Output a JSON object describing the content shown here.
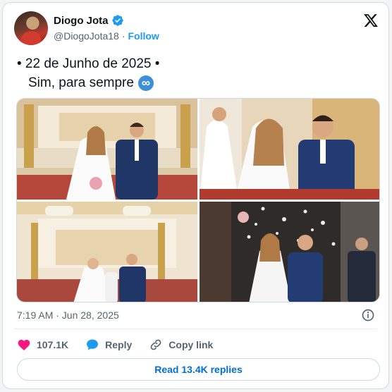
{
  "author": {
    "display_name": "Diogo Jota",
    "handle": "@DiogoJota18",
    "separator": "·",
    "follow_label": "Follow"
  },
  "tweet": {
    "line1": "• 22 de Junho de 2025 •",
    "line2": "Sim, para sempre",
    "emoji": "∞",
    "timestamp": "7:19 AM · Jun 28, 2025"
  },
  "actions": {
    "likes": "107.1K",
    "reply": "Reply",
    "copy_link": "Copy link"
  },
  "read_replies_label": "Read 13.4K replies",
  "colors": {
    "accent": "#1d9bf0",
    "link": "#006fd6",
    "like_heart": "#f91880",
    "reply_bubble": "#1d9bf0",
    "verified": "#1d9bf0"
  },
  "icons": [
    "verified-badge-icon",
    "x-logo-icon",
    "infinity-emoji-icon",
    "info-icon",
    "heart-icon",
    "reply-icon",
    "link-icon"
  ]
}
